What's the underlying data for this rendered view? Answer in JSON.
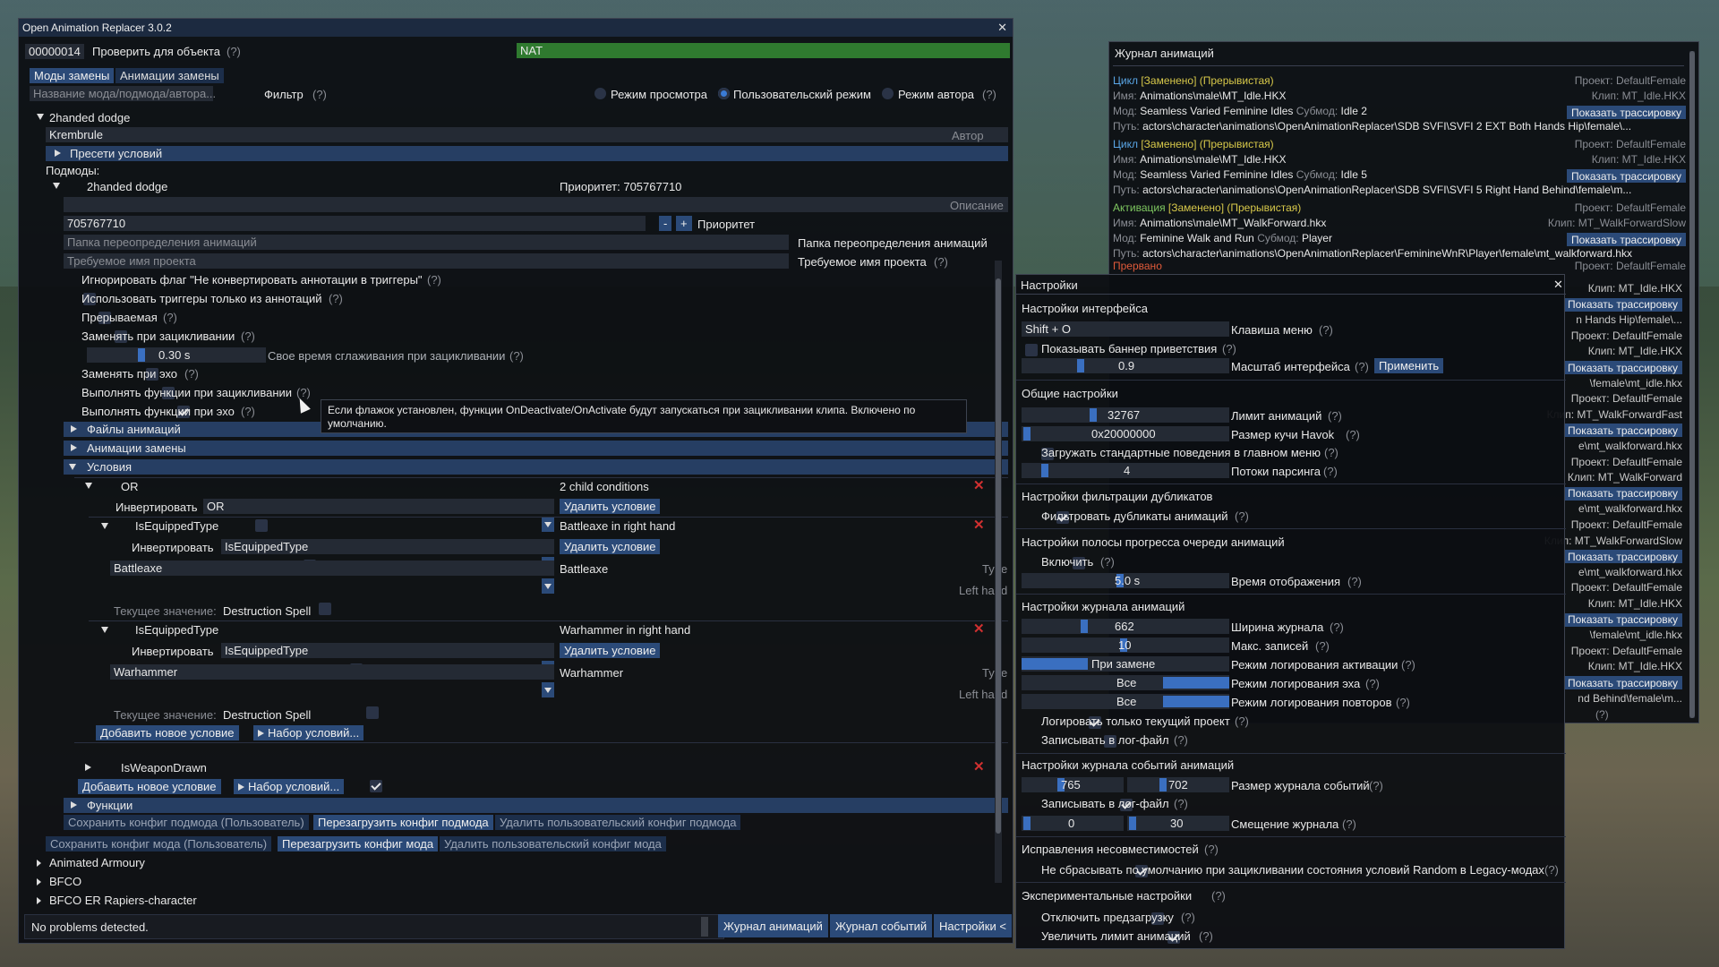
{
  "main": {
    "title": "Open Animation Replacer 3.0.2",
    "form_id": "00000014",
    "check_label": "Проверить для объекта",
    "target": "NAT",
    "tabs": [
      "Моды замены",
      "Анимации замены"
    ],
    "search_placeholder": "Название мода/подмода/автора...",
    "filter_label": "Фильтр",
    "modes": [
      "Режим просмотра",
      "Пользовательский режим",
      "Режим автора"
    ],
    "mod_name": "2handed dodge",
    "author_value": "Krembrule",
    "author_label": "Автор",
    "presets_label": "Пресети условий",
    "submods_label": "Подмоды:",
    "submod_name": "2handed dodge",
    "priority_text": "Приоритет: 705767710",
    "description_label": "Описание",
    "priority_value": "705767710",
    "minus": "-",
    "plus": "+",
    "priority_label": "Приоритет",
    "override_folder_placeholder": "Папка переопределения анимаций",
    "override_folder_label": "Папка переопределения анимаций",
    "project_placeholder": "Требуемое имя проекта",
    "project_label": "Требуемое имя проекта",
    "opt_ignore": "Игнорировать флаг \"Не конвертировать аннотации в триггеры\"",
    "opt_triggers": "Использовать триггеры только из аннотаций",
    "opt_interruptible": "Прерываемая",
    "opt_replace_loop": "Заменять при зацикливании",
    "blend_value": "0.30 s",
    "blend_label": "Свое время сглаживания при зацикливании",
    "opt_replace_echo": "Заменять при эхо",
    "opt_run_loop": "Выполнять функции при зацикливании",
    "opt_run_echo": "Выполнять функции при эхо",
    "tooltip": "Если флажок установлен, функции OnDeactivate/OnActivate будут запускаться при зацикливании клипа. Включено по умолчанию.",
    "sec_files": "Файлы анимаций",
    "sec_replacements": "Анимации замены",
    "sec_conditions": "Условия",
    "or_label": "OR",
    "or_children": "2 child conditions",
    "invert_label": "Инвертировать",
    "or_combo": "OR",
    "delete_condition": "Удалить условие",
    "cond1_name": "IsEquippedType",
    "cond1_desc": "Battleaxe in right hand",
    "cond1_combo": "IsEquippedType",
    "cond1_type": "Battleaxe",
    "cond1_type_value": "Battleaxe",
    "type_label": "Type",
    "left_hand_label": "Left hand",
    "current_value_label": "Текущее значение:",
    "current_value": "Destruction Spell",
    "cond2_name": "IsEquippedType",
    "cond2_desc": "Warhammer in right hand",
    "cond2_combo": "IsEquippedType",
    "cond2_type": "Warhammer",
    "cond2_type_value": "Warhammer",
    "add_condition": "Добавить новое условие",
    "condition_set": "Набор условий...",
    "cond3_name": "IsWeaponDrawn",
    "sec_functions": "Функции",
    "save_submod": "Сохранить конфиг подмода (Пользователь)",
    "reload_submod": "Перезагрузить конфиг подмода",
    "delete_submod": "Удалить пользовательский конфиг подмода",
    "save_mod": "Сохранить конфиг мода (Пользователь)",
    "reload_mod": "Перезагрузить конфиг мода",
    "delete_mod": "Удалить пользовательский конфиг мода",
    "mods": [
      "Animated Armoury",
      "BFCO",
      "BFCO ER Rapiers-character"
    ],
    "status": "No problems detected.",
    "btn_anim_log": "Журнал анимаций",
    "btn_event_log": "Журнал событий",
    "btn_settings": "Настройки <",
    "help": "(?)"
  },
  "log": {
    "title": "Журнал анимаций",
    "entries": [
      {
        "kind": "Цикл",
        "tags": "[Заменено] (Прерывистая)",
        "project": "Проект: DefaultFemale",
        "name_label": "Имя:",
        "name": "Animations\\male\\MT_Idle.HKX",
        "clip": "Клип: MT_Idle.HKX",
        "mod_label": "Мод:",
        "mod": "Seamless Varied Feminine Idles",
        "submod_label": "Субмод:",
        "submod": "Idle 2",
        "trace": "Показать трассировку",
        "path_label": "Путь:",
        "path": "actors\\character\\animations\\OpenAnimationReplacer\\SDB SVFI\\SVFI 2 EXT Both Hands Hip\\female\\..."
      },
      {
        "kind": "Цикл",
        "tags": "[Заменено] (Прерывистая)",
        "project": "Проект: DefaultFemale",
        "name_label": "Имя:",
        "name": "Animations\\male\\MT_Idle.HKX",
        "clip": "Клип: MT_Idle.HKX",
        "mod_label": "Мод:",
        "mod": "Seamless Varied Feminine Idles",
        "submod_label": "Субмод:",
        "submod": "Idle 5",
        "trace": "Показать трассировку",
        "path_label": "Путь:",
        "path": "actors\\character\\animations\\OpenAnimationReplacer\\SDB SVFI\\SVFI 5 Right Hand Behind\\female\\m..."
      },
      {
        "kind": "Активация",
        "tags": "[Заменено] (Прерывистая)",
        "project": "Проект: DefaultFemale",
        "name_label": "Имя:",
        "name": "Animations\\male\\MT_WalkForward.hkx",
        "clip": "Клип: MT_WalkForwardSlow",
        "mod_label": "Мод:",
        "mod": "Feminine Walk and Run",
        "submod_label": "Субмод:",
        "submod": "Player",
        "trace": "Показать трассировку",
        "path_label": "Путь:",
        "path": "actors\\character\\animations\\OpenAnimationReplacer\\FeminineWnR\\Player\\female\\mt_walkforward.hkx"
      }
    ],
    "interrupted": "Прервано",
    "interrupted_project": "Проект: DefaultFemale",
    "right_col": [
      {
        "text": "Клип: MT_Idle.HKX",
        "btn": false
      },
      {
        "text": "Показать трассировку",
        "btn": true
      },
      {
        "text": "n Hands Hip\\female\\...",
        "btn": false
      },
      {
        "text": "Проект: DefaultFemale",
        "btn": false
      },
      {
        "text": "Клип: MT_Idle.HKX",
        "btn": false
      },
      {
        "text": "Показать трассировку",
        "btn": true
      },
      {
        "text": "\\female\\mt_idle.hkx",
        "btn": false
      },
      {
        "text": "Проект: DefaultFemale",
        "btn": false
      },
      {
        "text": "Клип: MT_WalkForwardFast",
        "btn": false
      },
      {
        "text": "Показать трассировку",
        "btn": true
      },
      {
        "text": "e\\mt_walkforward.hkx",
        "btn": false
      },
      {
        "text": "Проект: DefaultFemale",
        "btn": false
      },
      {
        "text": "Клип: MT_WalkForward",
        "btn": false
      },
      {
        "text": "Показать трассировку",
        "btn": true
      },
      {
        "text": "e\\mt_walkforward.hkx",
        "btn": false
      },
      {
        "text": "Проект: DefaultFemale",
        "btn": false
      },
      {
        "text": "Клип: MT_WalkForwardSlow",
        "btn": false
      },
      {
        "text": "Показать трассировку",
        "btn": true
      },
      {
        "text": "e\\mt_walkforward.hkx",
        "btn": false
      },
      {
        "text": "Проект: DefaultFemale",
        "btn": false
      },
      {
        "text": "Клип: MT_Idle.HKX",
        "btn": false
      },
      {
        "text": "Показать трассировку",
        "btn": true
      },
      {
        "text": "\\female\\mt_idle.hkx",
        "btn": false
      },
      {
        "text": "Проект: DefaultFemale",
        "btn": false
      },
      {
        "text": "Клип: MT_Idle.HKX",
        "btn": false
      },
      {
        "text": "Показать трассировку",
        "btn": true
      },
      {
        "text": "nd Behind\\female\\m...",
        "btn": false
      }
    ],
    "help": "(?)"
  },
  "settings": {
    "title": "Настройки",
    "ui_section": "Настройки интерфейса",
    "menu_key_value": "Shift + O",
    "menu_key_label": "Клавиша меню",
    "show_banner": "Показывать баннер приветствия",
    "scale_value": "0.9",
    "scale_label": "Масштаб интерфейса",
    "apply": "Применить",
    "general_section": "Общие настройки",
    "anim_limit_value": "32767",
    "anim_limit_label": "Лимит анимаций",
    "havok_value": "0x20000000",
    "havok_label": "Размер кучи Havok",
    "load_default": "Загружать стандартные поведения в главном меню",
    "threads_value": "4",
    "threads_label": "Потоки парсинга",
    "dup_section": "Настройки фильтрации дубликатов",
    "filter_dups": "Фильтровать дубликаты анимаций",
    "progress_section": "Настройки полосы прогресса очереди анимаций",
    "enable": "Включить",
    "display_time_value": "5.0 s",
    "display_time_label": "Время отображения",
    "log_section": "Настройки журнала анимаций",
    "log_width_value": "662",
    "log_width_label": "Ширина журнала",
    "max_entries_value": "10",
    "max_entries_label": "Макс. записей",
    "activate_mode_value": "При замене",
    "activate_mode_label": "Режим логирования активации",
    "echo_mode_value": "Все",
    "echo_mode_label": "Режим логирования эха",
    "loop_mode_value": "Все",
    "loop_mode_label": "Режим логирования повторов",
    "log_current_only": "Логировать только текущий проект",
    "write_file": "Записывать в лог-файл",
    "events_section": "Настройки журнала событий анимаций",
    "event_w_value": "765",
    "event_h_value": "702",
    "event_size_label": "Размер журнала событий",
    "write_file2": "Записывать в лог-файл",
    "offset_x_value": "0",
    "offset_y_value": "30",
    "offset_label": "Смещение журнала",
    "compat_section": "Исправления несовместимостей",
    "compat_opt": "Не сбрасывать по умолчанию при зацикливании состояния условий Random в Legacy-модах",
    "exp_section": "Экспериментальные настройки",
    "disable_preload": "Отключить предзагрузку",
    "raise_limit": "Увеличить лимит анимаций",
    "help": "(?)"
  },
  "colors": {
    "accent": "#3a6fc0",
    "header": "#263e63",
    "button": "#2b4a78",
    "target": "#2f7a2f",
    "close": "#d03030"
  }
}
